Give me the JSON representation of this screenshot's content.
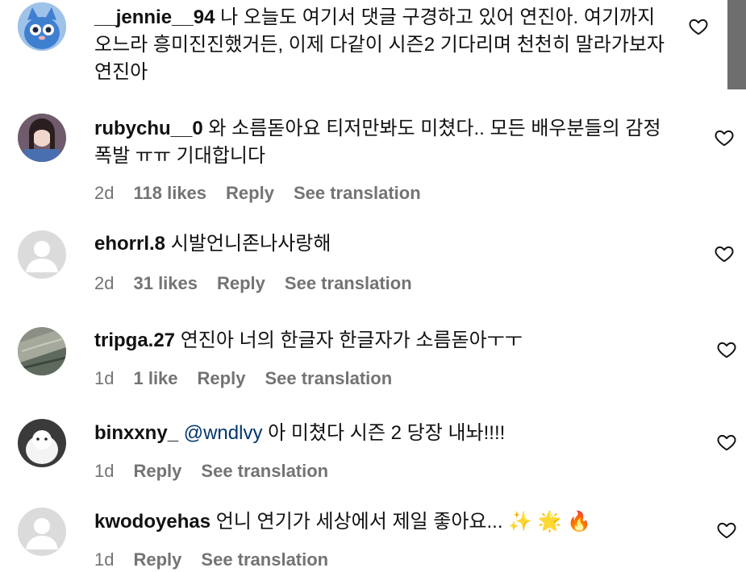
{
  "comments": [
    {
      "username": "__jennie__94",
      "text": "나 오늘도 여기서 댓글 구경하고 있어 연진아. 여기까지 오느라 흥미진진했거든, 이제 다같이 시즌2 기다리며 천천히 말라가보자 연진아",
      "avatar": "cat-cartoon-avatar"
    },
    {
      "username": "rubychu__0",
      "text": "와 소름돋아요 티저만봐도 미쳤다.. 모든 배우분들의 감정 폭발 ㅠㅠ 기대합니다",
      "time": "2d",
      "likes": "118 likes",
      "reply": "Reply",
      "see_translation": "See translation",
      "avatar": "woman-photo-avatar"
    },
    {
      "username": "ehorrl.8",
      "text": "시발언니존나사랑해",
      "time": "2d",
      "likes": "31 likes",
      "reply": "Reply",
      "see_translation": "See translation",
      "avatar": "default-avatar"
    },
    {
      "username": "tripga.27",
      "text": "연진아 너의 한글자 한글자가 소름돋아ㅜㅜ",
      "time": "1d",
      "likes": "1 like",
      "reply": "Reply",
      "see_translation": "See translation",
      "avatar": "landscape-photo-avatar"
    },
    {
      "username": "binxxny_",
      "mention": "@wndlvy",
      "text": "아 미쳤다 시즌 2 당장 내놔!!!!",
      "time": "1d",
      "reply": "Reply",
      "see_translation": "See translation",
      "avatar": "white-pet-avatar"
    },
    {
      "username": "kwodoyehas",
      "text": "언니 연기가 세상에서 제일 좋아요...",
      "emojis": "✨ 🌟 🔥",
      "time": "1d",
      "reply": "Reply",
      "see_translation": "See translation",
      "avatar": "default-avatar"
    }
  ],
  "colors": {
    "text": "#111111",
    "meta": "#737373",
    "mention": "#00376b",
    "scrollbar": "#6e6e6e"
  },
  "icons": {
    "like": "heart-outline-icon"
  }
}
